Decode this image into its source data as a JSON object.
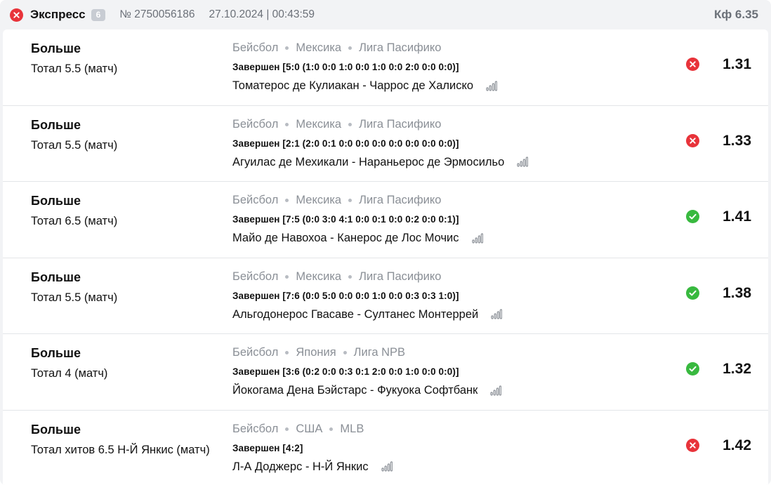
{
  "header": {
    "status": "lost",
    "title": "Экспресс",
    "count": "6",
    "number": "№ 2750056186",
    "datetime": "27.10.2024 | 00:43:59",
    "coef": "Кф 6.35"
  },
  "colors": {
    "lost": "#e8333a",
    "won": "#38b93f",
    "muted": "#8a8f96"
  },
  "bets": [
    {
      "type": "Больше",
      "market": "Тотал 5.5 (матч)",
      "sport": "Бейсбол",
      "country": "Мексика",
      "league": "Лига Пасифико",
      "result": "Завершен [5:0 (1:0 0:0 1:0 0:0 1:0 0:0 2:0 0:0 0:0)]",
      "match": "Томатерос де Кулиакан - Чаррос де Халиско",
      "status": "lost",
      "odds": "1.31"
    },
    {
      "type": "Больше",
      "market": "Тотал 5.5 (матч)",
      "sport": "Бейсбол",
      "country": "Мексика",
      "league": "Лига Пасифико",
      "result": "Завершен [2:1 (2:0 0:1 0:0 0:0 0:0 0:0 0:0 0:0 0:0)]",
      "match": "Агуилас де Мехикали - Нараньерос де Эрмосильо",
      "status": "lost",
      "odds": "1.33"
    },
    {
      "type": "Больше",
      "market": "Тотал 6.5 (матч)",
      "sport": "Бейсбол",
      "country": "Мексика",
      "league": "Лига Пасифико",
      "result": "Завершен [7:5 (0:0 3:0 4:1 0:0 0:1 0:0 0:2 0:0 0:1)]",
      "match": "Майо де Навохоа - Канерос де Лос Мочис",
      "status": "won",
      "odds": "1.41"
    },
    {
      "type": "Больше",
      "market": "Тотал 5.5 (матч)",
      "sport": "Бейсбол",
      "country": "Мексика",
      "league": "Лига Пасифико",
      "result": "Завершен [7:6 (0:0 5:0 0:0 0:0 1:0 0:0 0:3 0:3 1:0)]",
      "match": "Альгодонерос Гвасаве - Султанес Монтеррей",
      "status": "won",
      "odds": "1.38"
    },
    {
      "type": "Больше",
      "market": "Тотал 4 (матч)",
      "sport": "Бейсбол",
      "country": "Япония",
      "league": "Лига NPB",
      "result": "Завершен [3:6 (0:2 0:0 0:3 0:1 2:0 0:0 1:0 0:0 0:0)]",
      "match": "Йокогама Дена Бэйстарс - Фукуока Софтбанк",
      "status": "won",
      "odds": "1.32"
    },
    {
      "type": "Больше",
      "market": "Тотал хитов 6.5 Н-Й Янкис (матч)",
      "sport": "Бейсбол",
      "country": "США",
      "league": "MLB",
      "result": "Завершен [4:2]",
      "match": "Л-А Доджерс - Н-Й Янкис",
      "status": "lost",
      "odds": "1.42"
    }
  ]
}
